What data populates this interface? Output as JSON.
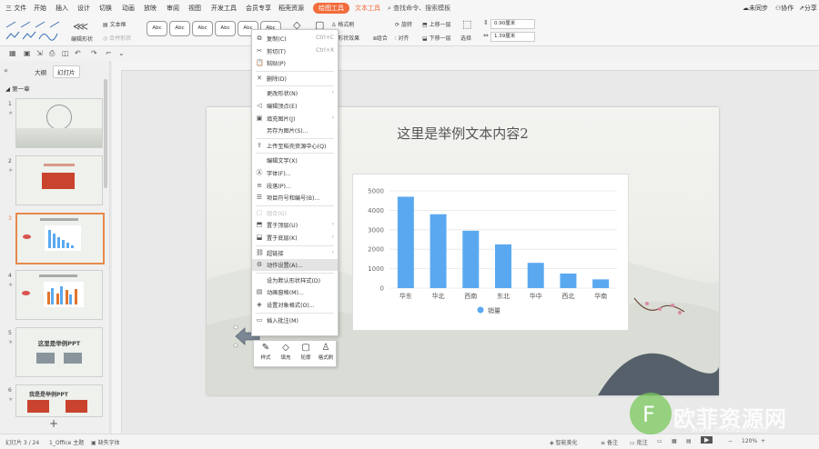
{
  "menubar": {
    "items": [
      "三 文件",
      "开始",
      "插入",
      "设计",
      "切换",
      "动画",
      "放映",
      "审阅",
      "视图",
      "开发工具",
      "会员专享",
      "稻壳资源"
    ],
    "drawing_tools": "绘图工具",
    "text_tools": "文本工具",
    "search": "查找命令、搜索模板",
    "sync": "未同步",
    "collab": "协作",
    "share": "分享",
    "accent": "#f26b3a"
  },
  "ribbon": {
    "edit_shape": "编辑形状",
    "textbox": "文本框",
    "merge_shape": "合并形状",
    "style_samples": [
      "Abc",
      "Abc",
      "Abc",
      "Abc",
      "Abc",
      "Abc"
    ],
    "format_brush": "格式刷",
    "shape_effect": "形状效果",
    "rotate": "旋转",
    "align": "对齐",
    "group": "组合",
    "up_layer": "上移一层",
    "down_layer": "下移一层",
    "select": "选择",
    "height": "0.90厘米",
    "width": "1.39厘米"
  },
  "leftpanel": {
    "tab_outline": "大纲",
    "tab_slides": "幻灯片",
    "section": "第一章",
    "slide_numbers": [
      "1",
      "2",
      "3",
      "4",
      "5",
      "6"
    ],
    "thumb5_title": "这里是举例PPT",
    "thumb6_title": "我是是举例PPT",
    "add": "+"
  },
  "slide": {
    "title": "这里是举例文本内容2"
  },
  "chart_data": {
    "type": "bar",
    "categories": [
      "华东",
      "华北",
      "西南",
      "东北",
      "华中",
      "西北",
      "华南"
    ],
    "series": [
      {
        "name": "销量",
        "values": [
          4700,
          3800,
          2950,
          2250,
          1300,
          750,
          450
        ]
      }
    ],
    "ylim": [
      0,
      5000
    ],
    "yticks": [
      "0",
      "1000",
      "2000",
      "3000",
      "4000",
      "5000"
    ],
    "grid": true,
    "legend": "bottom",
    "color": "#5aa9f0"
  },
  "context_menu": {
    "items": [
      {
        "icon": "copy-icon",
        "glyph": "⧉",
        "label": "复制(C)",
        "shortcut": "Ctrl+C"
      },
      {
        "icon": "cut-icon",
        "glyph": "✂",
        "label": "剪切(T)",
        "shortcut": "Ctrl+X"
      },
      {
        "icon": "paste-icon",
        "glyph": "📋",
        "label": "粘贴(P)",
        "shortcut": ""
      },
      {
        "icon": "delete-icon",
        "glyph": "✕",
        "label": "删除(D)",
        "shortcut": ""
      },
      {
        "icon": "change-shape-icon",
        "glyph": " ",
        "label": "更改形状(N)",
        "shortcut": "›"
      },
      {
        "icon": "edit-vertex-icon",
        "glyph": "◁",
        "label": "编辑顶点(E)",
        "shortcut": ""
      },
      {
        "icon": "fill-image-icon",
        "glyph": "▣",
        "label": "填充图片(J)",
        "shortcut": "›"
      },
      {
        "icon": "save-image-icon",
        "glyph": " ",
        "label": "另存为图片(S)...",
        "shortcut": ""
      },
      {
        "icon": "upload-icon",
        "glyph": "⇪",
        "label": "上传至稻壳资源中心(Q)",
        "shortcut": ""
      },
      {
        "icon": "edit-text-icon",
        "glyph": " ",
        "label": "编辑文字(X)",
        "shortcut": ""
      },
      {
        "icon": "font-icon",
        "glyph": "Ⓐ",
        "label": "字体(F)...",
        "shortcut": ""
      },
      {
        "icon": "paragraph-icon",
        "glyph": "≡",
        "label": "段落(P)...",
        "shortcut": ""
      },
      {
        "icon": "bullets-icon",
        "glyph": "☰",
        "label": "项目符号和编号(B)...",
        "shortcut": ""
      },
      {
        "icon": "group-icon",
        "glyph": "▢",
        "label": "组合(G)",
        "shortcut": ""
      },
      {
        "icon": "bring-front-icon",
        "glyph": "⬒",
        "label": "置于顶层(U)",
        "shortcut": "›"
      },
      {
        "icon": "send-back-icon",
        "glyph": "⬓",
        "label": "置于底层(K)",
        "shortcut": "›"
      },
      {
        "icon": "hyperlink-icon",
        "glyph": "⛓",
        "label": "超链接",
        "shortcut": "›"
      },
      {
        "icon": "action-settings-icon",
        "glyph": "⚙",
        "label": "动作设置(A)...",
        "shortcut": ""
      },
      {
        "icon": "default-style-icon",
        "glyph": " ",
        "label": "设为默认形状样式(D)",
        "shortcut": ""
      },
      {
        "icon": "animation-pane-icon",
        "glyph": "▤",
        "label": "动画窗格(M)...",
        "shortcut": ""
      },
      {
        "icon": "format-object-icon",
        "glyph": "◈",
        "label": "设置对象格式(O)...",
        "shortcut": ""
      },
      {
        "icon": "comment-icon",
        "glyph": "▭",
        "label": "插入批注(M)",
        "shortcut": ""
      }
    ]
  },
  "minibar": {
    "items": [
      {
        "icon": "style-icon",
        "glyph": "✎",
        "label": "样式"
      },
      {
        "icon": "fill-icon",
        "glyph": "◇",
        "label": "填充"
      },
      {
        "icon": "outline-icon",
        "glyph": "▢",
        "label": "轮廓"
      },
      {
        "icon": "format-brush-icon",
        "glyph": "♙",
        "label": "格式刷"
      }
    ]
  },
  "statusbar": {
    "slide_info": "幻灯片 3 / 24",
    "theme": "1_Office 主题",
    "missing_font": "缺失字体",
    "smart_beautify": "智能美化",
    "notes": "备注",
    "comments": "批注",
    "zoom": "120%"
  },
  "watermark": {
    "text": "欧菲资源网",
    "url": "www.office26.com"
  }
}
